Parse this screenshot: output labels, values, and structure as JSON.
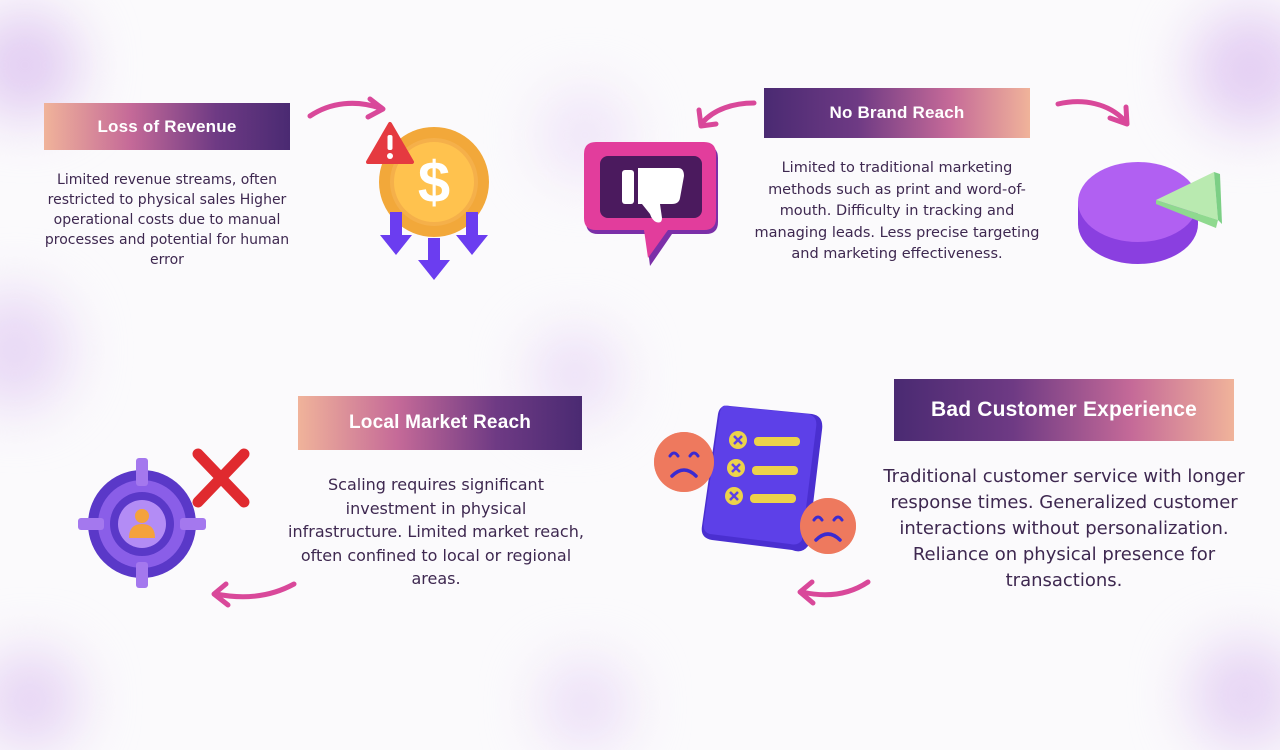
{
  "sections": {
    "loss_of_revenue": {
      "title": "Loss of Revenue",
      "text": "Limited revenue streams, often restricted to physical sales Higher operational costs due to manual processes and potential for human error"
    },
    "no_brand_reach": {
      "title": "No Brand Reach",
      "text": "Limited to traditional marketing methods such as print and word-of-mouth. Difficulty in tracking and managing leads. Less precise targeting and marketing effectiveness."
    },
    "local_market_reach": {
      "title": "Local Market Reach",
      "text": "Scaling requires significant investment in physical infrastructure. Limited market reach, often confined to local or regional areas."
    },
    "bad_customer_experience": {
      "title": "Bad Customer Experience",
      "text": "Traditional customer service with longer response times.  Generalized customer interactions without personalization. Reliance on physical presence for transactions."
    }
  },
  "icons": [
    "dollar-coin-warning-icon",
    "thumbs-down-speech-bubble-icon",
    "pie-chart-icon",
    "target-user-crossed-icon",
    "sad-receipt-icon"
  ],
  "colors": {
    "purple_dark": "#4a2a72",
    "peach": "#f0b39a",
    "pink_arrow": "#d9489a",
    "text": "#3e2850"
  }
}
